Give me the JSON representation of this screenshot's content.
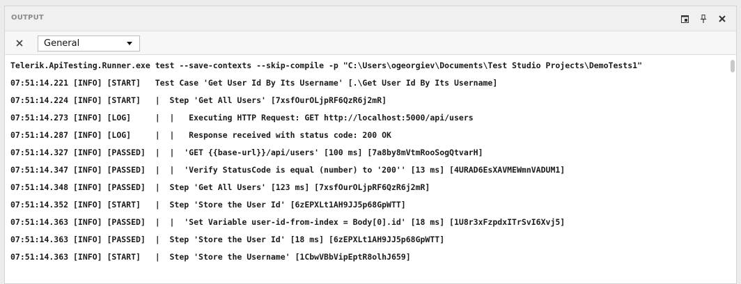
{
  "panel": {
    "title": "OUTPUT",
    "icons": {
      "float": "float-window-icon",
      "pin": "pin-icon",
      "close": "close-icon"
    }
  },
  "toolbar": {
    "clear_icon": "clear-output-icon",
    "source_selected": "General"
  },
  "output": {
    "lines": [
      "Telerik.ApiTesting.Runner.exe test --save-contexts --skip-compile -p \"C:\\Users\\ogeorgiev\\Documents\\Test Studio Projects\\DemoTests1\"",
      "07:51:14.221 [INFO] [START]   Test Case 'Get User Id By Its Username' [.\\Get User Id By Its Username]",
      "07:51:14.224 [INFO] [START]   |  Step 'Get All Users' [7xsfOurOLjpRF6QzR6j2mR]",
      "07:51:14.273 [INFO] [LOG]     |  |   Executing HTTP Request: GET http://localhost:5000/api/users",
      "07:51:14.287 [INFO] [LOG]     |  |   Response received with status code: 200 OK",
      "07:51:14.327 [INFO] [PASSED]  |  |  'GET {{base-url}}/api/users' [100 ms] [7a8by8mVtmRooSogQtvarH]",
      "07:51:14.347 [INFO] [PASSED]  |  |  'Verify StatusCode is equal (number) to '200'' [13 ms] [4URAD6EsXAVMEWmnVADUM1]",
      "07:51:14.348 [INFO] [PASSED]  |  Step 'Get All Users' [123 ms] [7xsfOurOLjpRF6QzR6j2mR]",
      "07:51:14.352 [INFO] [START]   |  Step 'Store the User Id' [6zEPXLt1AH9JJ5p68GpWTT]",
      "07:51:14.363 [INFO] [PASSED]  |  |  'Set Variable user-id-from-index = Body[0].id' [18 ms] [1U8r3xFzpdxITrSvI6Xvj5]",
      "07:51:14.363 [INFO] [PASSED]  |  Step 'Store the User Id' [18 ms] [6zEPXLt1AH9JJ5p68GpWTT]",
      "07:51:14.363 [INFO] [START]   |  Step 'Store the Username' [1CbwVBbVipEptR8olhJ659]"
    ]
  }
}
